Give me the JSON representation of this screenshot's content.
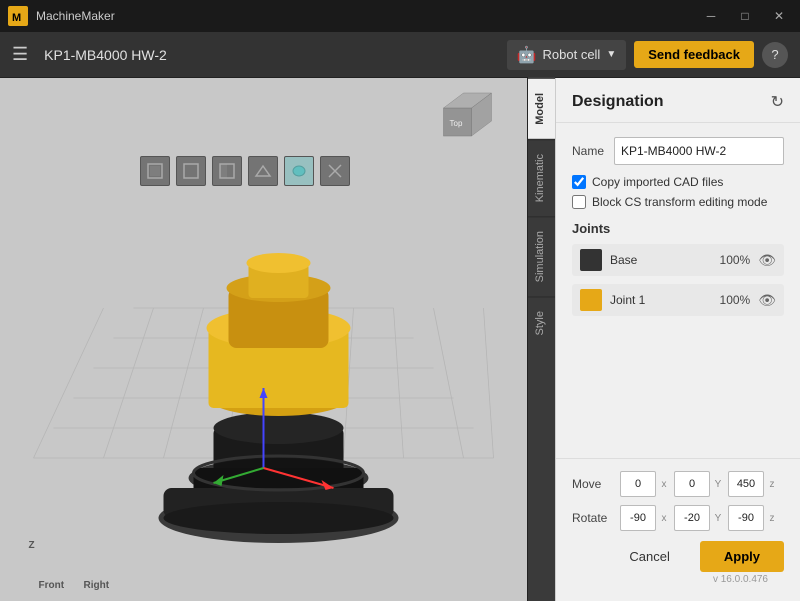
{
  "titlebar": {
    "app_name": "MachineMaker",
    "project": "KP1-MB4000 HW-2",
    "min_label": "─",
    "max_label": "□",
    "close_label": "✕"
  },
  "toolbar": {
    "hamburger_icon": "☰",
    "project_title": "KP1-MB4000 HW-2",
    "robot_cell_label": "Robot cell",
    "robot_icon": "🤖",
    "dropdown_arrow": "▼",
    "feedback_label": "Send feedback",
    "help_label": "?"
  },
  "view_tools": [
    {
      "id": "box-solid",
      "icon": "⬜",
      "title": "Solid"
    },
    {
      "id": "box-wire",
      "icon": "⬡",
      "title": "Wireframe"
    },
    {
      "id": "box-half",
      "icon": "▣",
      "title": "Half"
    },
    {
      "id": "terrain",
      "icon": "◇",
      "title": "Terrain"
    },
    {
      "id": "mesh",
      "icon": "⬟",
      "title": "Mesh"
    },
    {
      "id": "crosshair",
      "icon": "✕",
      "title": "Reset"
    }
  ],
  "side_tabs": [
    {
      "id": "model",
      "label": "Model",
      "active": true
    },
    {
      "id": "kinematic",
      "label": "Kinematic",
      "active": false
    },
    {
      "id": "simulation",
      "label": "Simulation",
      "active": false
    },
    {
      "id": "style",
      "label": "Style",
      "active": false
    }
  ],
  "panel": {
    "title": "Designation",
    "refresh_icon": "↻",
    "name_label": "Name",
    "name_value": "KP1-MB4000 HW-2",
    "checkbox1_label": "Copy imported CAD files",
    "checkbox1_checked": true,
    "checkbox2_label": "Block CS transform editing mode",
    "checkbox2_checked": false,
    "joints_label": "Joints",
    "joints": [
      {
        "id": "base",
        "color": "#333333",
        "name": "Base",
        "pct": "100%",
        "visible": true
      },
      {
        "id": "joint1",
        "color": "#e6a817",
        "name": "Joint 1",
        "pct": "100%",
        "visible": true
      }
    ]
  },
  "bottom": {
    "move_label": "Move",
    "move_x": "0",
    "move_y": "0",
    "move_z": "450",
    "rotate_label": "Rotate",
    "rotate_x": "-90",
    "rotate_y": "-20",
    "rotate_z": "-90",
    "cancel_label": "Cancel",
    "apply_label": "Apply",
    "version": "v 16.0.0.476"
  },
  "viewport": {
    "front_label": "Front",
    "right_label": "Right",
    "top_label": "Top"
  }
}
